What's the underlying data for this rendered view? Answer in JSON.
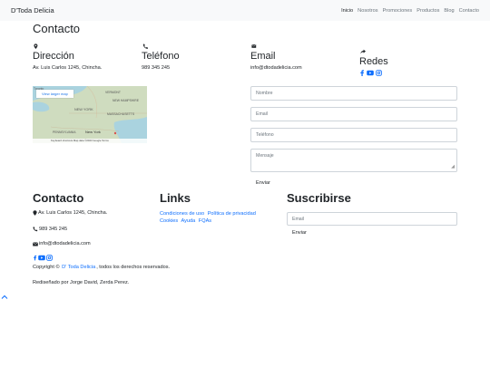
{
  "navbar": {
    "brand": "D'Toda Delicia",
    "links": [
      "Inicio",
      "Nosotros",
      "Promociones",
      "Productos",
      "Blog",
      "Contacto"
    ]
  },
  "contact": {
    "heading": "Contacto",
    "address": {
      "title": "Dirección",
      "value": "Av. Luis Carlos 1245, Chincha."
    },
    "phone": {
      "title": "Teléfono",
      "value": "989 345 245"
    },
    "email": {
      "title": "Email",
      "value": "info@dtodadelicia.com"
    },
    "social": {
      "title": "Redes"
    }
  },
  "map": {
    "button_label": "View larger map",
    "footer_text": "Keyboard shortcuts   Map data ©2023 Google   Terms",
    "place_labels": [
      "VERMONT",
      "NEW HAMPSHIRE",
      "NEW YORK",
      "MASSACHUSETTS",
      "PENNSYLVANIA",
      "New York",
      "Toronto"
    ]
  },
  "form": {
    "name_placeholder": "Nombre",
    "email_placeholder": "Email",
    "phone_placeholder": "Teléfono",
    "message_placeholder": "Mensaje",
    "send_label": "Enviar"
  },
  "footer": {
    "contact_heading": "Contacto",
    "address": "Av. Luis Carlos 1245, Chincha.",
    "phone": "989 345 245",
    "email": "info@dtodadelicia.com",
    "copyright_prefix": "Copyright © ",
    "copyright_link": "D' Toda Delicia",
    "copyright_suffix": ", todos los derechos reservados.",
    "credit": "Rediseñado por Jorge David, Zerda Perez.",
    "links_heading": "Links",
    "links": [
      "Condiciones de uso",
      "Política de privacidad",
      "Cookies",
      "Ayuda",
      "FQAs"
    ],
    "subscribe_heading": "Suscribirse",
    "subscribe_placeholder": "Email",
    "subscribe_button": "Enviar"
  },
  "colors": {
    "navbar_bg": "#f8f9fa",
    "link": "#0d6efd",
    "text": "#212529"
  },
  "icons": [
    "map-marker-icon",
    "phone-icon",
    "envelope-icon",
    "share-icon",
    "facebook-icon",
    "youtube-icon",
    "instagram-icon",
    "chevron-up-icon"
  ]
}
